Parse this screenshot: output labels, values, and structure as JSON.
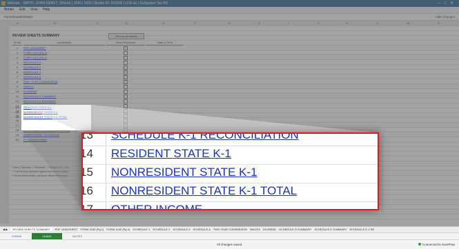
{
  "window": {
    "title": "SMondo - SMITH, JOHN (00HVT_03Smt) | 1040 | 2023 | Binder ID: 523532 | LDS-on | GoSystem Tax RS"
  },
  "menu": [
    "Binder",
    "Edit",
    "View",
    "Help"
  ],
  "path": {
    "text": "Forms\\Leads\\Sheets",
    "hide_label": "Hide Changes"
  },
  "sheet": {
    "title": "REVIEW SHEETS SUMMARY",
    "review_button": "Review all sheets",
    "headers": {
      "no": "Sr No",
      "leadsheets": "Leadsheets",
      "reviewed": "Sheet Reviewed",
      "datetime": "Date & Time"
    },
    "rows": [
      {
        "n": "1",
        "label": "PDF LEADSHEET"
      },
      {
        "n": "2",
        "label": "FORM 1040 (Pg 1)"
      },
      {
        "n": "3",
        "label": "FORM 1040 (Pg 2)"
      },
      {
        "n": "4",
        "label": "SCHEDULE 1"
      },
      {
        "n": "5",
        "label": "SCHEDULE 2"
      },
      {
        "n": "6",
        "label": "SCHEDULE 3"
      },
      {
        "n": "7",
        "label": "SCHEDULE A"
      },
      {
        "n": "8",
        "label": "TWO YEAR COMPARISON"
      },
      {
        "n": "9",
        "label": "WAGES"
      },
      {
        "n": "10",
        "label": "DIVIDEND"
      },
      {
        "n": "11",
        "label": "SCHEDULE D SUMMARY"
      },
      {
        "n": "12",
        "label": "SCHEDULE E SUMMARY"
      },
      {
        "n": "13",
        "label": "SCHEDULE K-1 RECONCILIATION"
      },
      {
        "n": "14",
        "label": "RESIDENT STATE K-1"
      },
      {
        "n": "15",
        "label": "NONRESIDENT STATE K-1"
      },
      {
        "n": "16",
        "label": "NONRESIDENT STATE K-1 TOTAL"
      },
      {
        "n": "17",
        "label": "OTHER INCOME"
      },
      {
        "n": "18",
        "label": "MORTGAGE INTEREST LIMITATION"
      },
      {
        "n": "19",
        "label": "UNREPORTED TIP INCOME"
      },
      {
        "n": "20",
        "label": "PY Deleted Entities"
      }
    ],
    "notes": [
      "Green Tickmark = Reviewed , Change icon = Mo...",
      "* The Review tickmark against the sheet's name...",
      "* To Unreview sheet, uncheck 'Sheet Reviewed'..."
    ]
  },
  "zoom": {
    "rows": [
      {
        "n": "13",
        "label": "SCHEDULE K-1 RECONCILIATION"
      },
      {
        "n": "14",
        "label": "RESIDENT STATE K-1"
      },
      {
        "n": "15",
        "label": "NONRESIDENT STATE K-1"
      },
      {
        "n": "16",
        "label": "NONRESIDENT STATE K-1 TOTAL"
      },
      {
        "n": "17",
        "label": "OTHER INCOME"
      }
    ],
    "border_color": "#e01b24"
  },
  "tabs": [
    "REVIEW SHEETS SUMMARY",
    "PDF LEADSHEET",
    "FORM 1040 (Pg 1)",
    "FORM 1040 (Pg 2)",
    "SCHEDULE 1",
    "SCHEDULE 2",
    "SCHEDULE 3",
    "SCHEDULE A",
    "TWO YEAR COMPARISON",
    "WAGES",
    "DIVIDEND",
    "SCHEDULE D SUMMARY",
    "SCHEDULE E SUMMARY",
    "SCHEDULE K-1 RE"
  ],
  "bottom_nav": [
    "FORMS",
    "LEADS",
    "NOTES"
  ],
  "status": {
    "center": "All changes saved.",
    "right": "Connected to SurePrep"
  }
}
